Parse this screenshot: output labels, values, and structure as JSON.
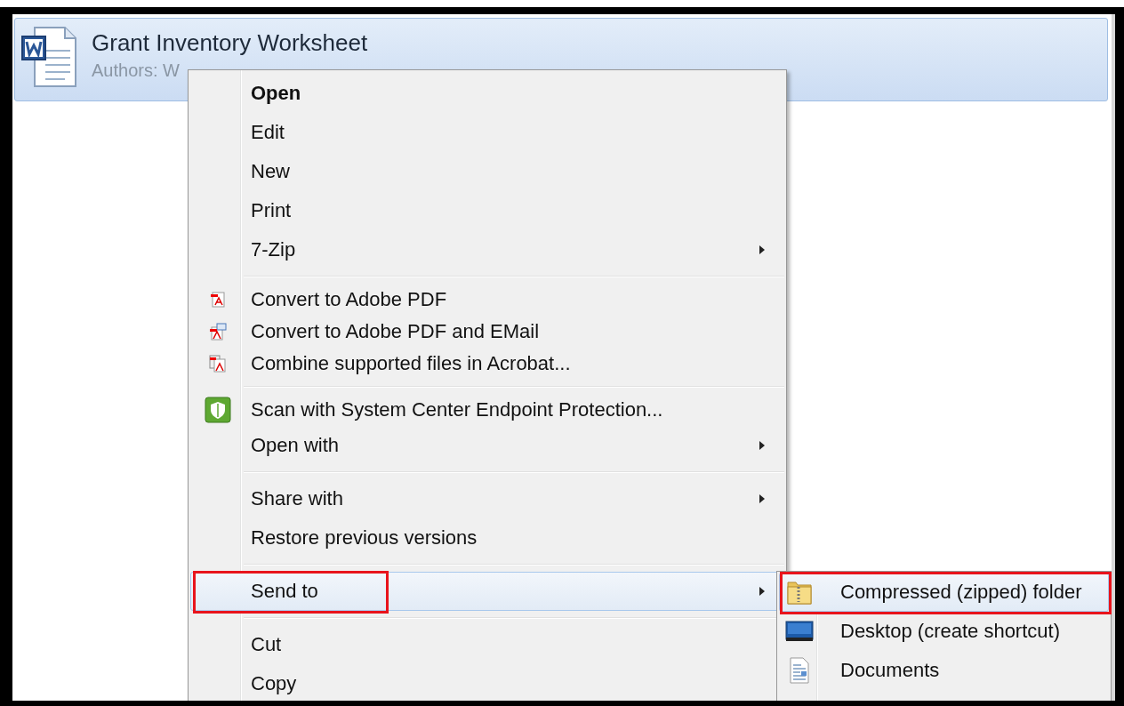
{
  "file": {
    "title": "Grant Inventory Worksheet",
    "subtitle": "Authors: W",
    "selected": true
  },
  "context_menu": {
    "groups": [
      [
        {
          "label": "Open",
          "default": true,
          "submenu": false,
          "selected": false,
          "annotated": false
        },
        {
          "label": "Edit",
          "default": false,
          "submenu": false,
          "selected": false,
          "annotated": false
        },
        {
          "label": "New",
          "default": false,
          "submenu": false,
          "selected": false,
          "annotated": false
        },
        {
          "label": "Print",
          "default": false,
          "submenu": false,
          "selected": false,
          "annotated": false
        },
        {
          "label": "7-Zip",
          "default": false,
          "submenu": true,
          "selected": false,
          "annotated": false
        }
      ],
      [
        {
          "label": "Convert to Adobe PDF",
          "default": false,
          "submenu": false,
          "selected": false,
          "annotated": false
        },
        {
          "label": "Convert to Adobe PDF and EMail",
          "default": false,
          "submenu": false,
          "selected": false,
          "annotated": false
        },
        {
          "label": "Combine supported files in Acrobat...",
          "default": false,
          "submenu": false,
          "selected": false,
          "annotated": false
        }
      ],
      [
        {
          "label": "Scan with System Center Endpoint Protection...",
          "default": false,
          "submenu": false,
          "selected": false,
          "annotated": false
        },
        {
          "label": "Open with",
          "default": false,
          "submenu": true,
          "selected": false,
          "annotated": false
        }
      ],
      [
        {
          "label": "Share with",
          "default": false,
          "submenu": true,
          "selected": false,
          "annotated": false
        },
        {
          "label": "Restore previous versions",
          "default": false,
          "submenu": false,
          "selected": false,
          "annotated": false
        }
      ],
      [
        {
          "label": "Send to",
          "default": false,
          "submenu": true,
          "selected": true,
          "annotated": true
        }
      ],
      [
        {
          "label": "Cut",
          "default": false,
          "submenu": false,
          "selected": false,
          "annotated": false
        },
        {
          "label": "Copy",
          "default": false,
          "submenu": false,
          "selected": false,
          "annotated": false
        }
      ]
    ]
  },
  "send_to_menu": {
    "items": [
      {
        "label": "Compressed (zipped) folder",
        "selected": true,
        "annotated": true
      },
      {
        "label": "Desktop (create shortcut)",
        "selected": false,
        "annotated": false
      },
      {
        "label": "Documents",
        "selected": false,
        "annotated": false
      }
    ]
  }
}
